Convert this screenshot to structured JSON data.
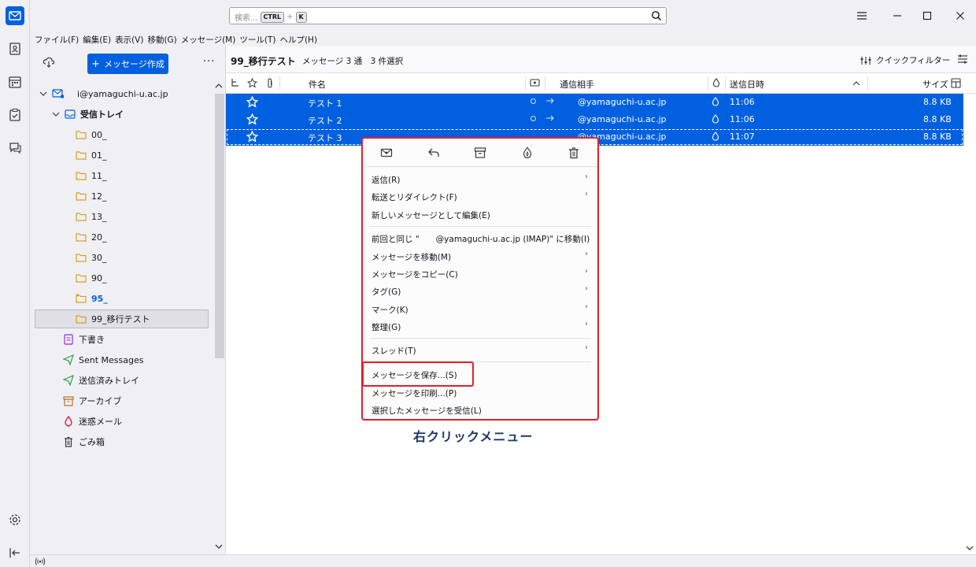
{
  "app": {
    "spaces": [
      "mail-icon",
      "address-book-icon",
      "calendar-icon",
      "tasks-icon",
      "chat-icon",
      "settings-icon",
      "collapse-icon"
    ]
  },
  "search": {
    "placeholder": "検索...",
    "key1": "CTRL",
    "plus": "+",
    "key2": "K"
  },
  "menubar": [
    "ファイル(F)",
    "編集(E)",
    "表示(V)",
    "移動(G)",
    "メッセージ(M)",
    "ツール(T)",
    "ヘルプ(H)"
  ],
  "folder_pane": {
    "compose_label": "メッセージ作成",
    "more": "···",
    "account": "i@yamaguchi-u.ac.jp",
    "inbox": "受信トレイ",
    "folders": [
      "00_",
      "01_",
      "11_",
      "12_",
      "13_",
      "20_",
      "30_",
      "90_",
      "95_",
      "99_移行テスト"
    ],
    "special": [
      "下書き",
      "Sent Messages",
      "送信済みトレイ",
      "アーカイブ",
      "迷惑メール",
      "ごみ箱"
    ]
  },
  "thread_pane": {
    "folder_name": "99_移行テスト",
    "count": "メッセージ 3 通　3 件選択",
    "quick_filter": "クイックフィルター",
    "columns": {
      "subject": "件名",
      "correspondent": "通信相手",
      "date": "送信日時",
      "size": "サイズ"
    },
    "rows": [
      {
        "subject": "テスト 1",
        "correspondent": "@yamaguchi-u.ac.jp",
        "date": "11:06",
        "size": "8.8 KB"
      },
      {
        "subject": "テスト 2",
        "correspondent": "@yamaguchi-u.ac.jp",
        "date": "11:06",
        "size": "8.8 KB"
      },
      {
        "subject": "テスト 3",
        "correspondent": "@yamaguchi-u.ac.jp",
        "date": "11:07",
        "size": "8.8 KB"
      }
    ]
  },
  "context_menu": {
    "icons": [
      "mark-read-icon",
      "reply-icon",
      "archive-icon",
      "junk-icon",
      "delete-icon"
    ],
    "items": [
      {
        "label": "返信(R)",
        "submenu": true
      },
      {
        "label": "転送とリダイレクト(F)",
        "submenu": true
      },
      {
        "label": "新しいメッセージとして編集(E)",
        "submenu": false
      },
      {
        "label": "前回と同じ \"　　@yamaguchi-u.ac.jp (IMAP)\" に移動(I)",
        "submenu": false
      },
      {
        "label": "メッセージを移動(M)",
        "submenu": true
      },
      {
        "label": "メッセージをコピー(C)",
        "submenu": true
      },
      {
        "label": "タグ(G)",
        "submenu": true
      },
      {
        "label": "マーク(K)",
        "submenu": true
      },
      {
        "label": "整理(G)",
        "submenu": true
      },
      {
        "label": "スレッド(T)",
        "submenu": true
      },
      {
        "label": "メッセージを保存...(S)",
        "submenu": false
      },
      {
        "label": "メッセージを印刷...(P)",
        "submenu": false
      },
      {
        "label": "選択したメッセージを受信(L)",
        "submenu": false
      }
    ],
    "chevron": "›"
  },
  "annotation": {
    "caption": "右クリックメニュー",
    "highlight_color": "#e0202a"
  },
  "colors": {
    "accent": "#0060df",
    "caption": "#1f3864"
  }
}
